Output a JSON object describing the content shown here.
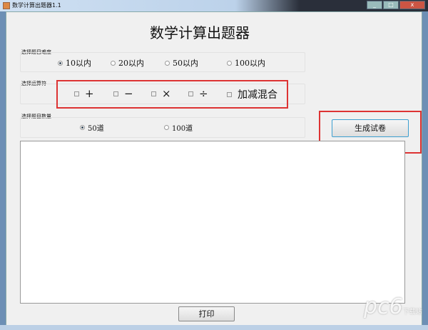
{
  "window": {
    "title": "数学计算出题器1.1",
    "buttons": [
      "minimize",
      "maximize",
      "close"
    ]
  },
  "heading": "数学计算出题器",
  "difficulty": {
    "label": "选择题目难度",
    "options": [
      "10以内",
      "20以内",
      "50以内",
      "100以内"
    ],
    "selected": "10以内"
  },
  "operators": {
    "label": "选择运算符",
    "options": [
      "+",
      "−",
      "×",
      "÷",
      "加减混合"
    ],
    "checked": []
  },
  "count": {
    "label": "选择题目数量",
    "options": [
      "50道",
      "100道"
    ],
    "selected": "50道"
  },
  "generate_label": "生成试卷",
  "output_text": "",
  "print_label": "打印",
  "watermark": "pc6 下载站",
  "colors": {
    "highlight": "#dd3333",
    "button_focus": "#3c9fd0"
  }
}
